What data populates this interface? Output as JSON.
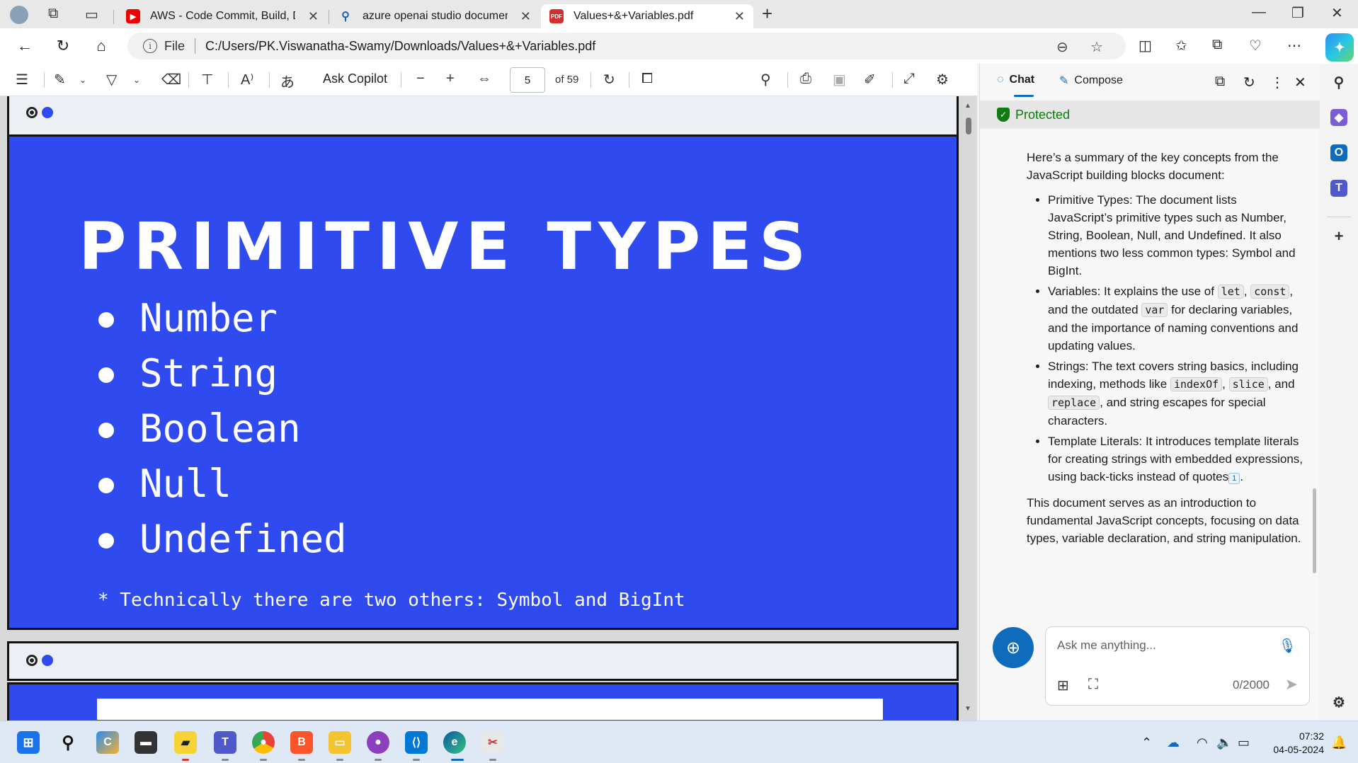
{
  "browser": {
    "tabs": [
      {
        "label": "AWS - Code Commit, Build, Depl",
        "icon": "youtube-icon"
      },
      {
        "label": "azure openai studio documentat",
        "icon": "search-icon"
      },
      {
        "label": "Values+&+Variables.pdf",
        "icon": "pdf-icon",
        "active": true
      }
    ],
    "address": {
      "scheme_label": "File",
      "url": "C:/Users/PK.Viswanatha-Swamy/Downloads/Values+&+Variables.pdf"
    }
  },
  "pdf_toolbar": {
    "ask_copilot": "Ask Copilot",
    "page_current": "5",
    "page_total": "of 59"
  },
  "slide": {
    "title": "PRIMITIVE TYPES",
    "items": [
      "Number",
      "String",
      "Boolean",
      "Null",
      "Undefined"
    ],
    "note": "* Technically there are two others: Symbol and BigInt"
  },
  "copilot": {
    "tabs": {
      "chat": "Chat",
      "compose": "Compose"
    },
    "protected": "Protected",
    "intro": "Here’s a summary of the key concepts from the JavaScript building blocks document:",
    "bullets": {
      "b1": "Primitive Types: The document lists JavaScript’s primitive types such as Number, String, Boolean, Null, and Undefined. It also mentions two less common types: Symbol and BigInt.",
      "b2_a": "Variables: It explains the use of ",
      "b2_code1": "let",
      "b2_b": ", ",
      "b2_code2": "const",
      "b2_c": ", and the outdated ",
      "b2_code3": "var",
      "b2_d": " for declaring variables, and the importance of naming conventions and updating values.",
      "b3_a": "Strings: The text covers string basics, including indexing, methods like ",
      "b3_code1": "indexOf",
      "b3_b": ", ",
      "b3_code2": "slice",
      "b3_c": ", and ",
      "b3_code3": "replace",
      "b3_d": ", and string escapes for special characters.",
      "b4": "Template Literals: It introduces template literals for creating strings with embedded expressions, using back-ticks instead of quotes",
      "b4_cite": "1",
      "b4_end": "."
    },
    "outro": "This document serves as an introduction to fundamental JavaScript concepts, focusing on data types, variable declaration, and string manipulation.",
    "input_placeholder": "Ask me anything...",
    "char_counter": "0/2000"
  },
  "taskbar": {
    "time": "07:32",
    "date": "04-05-2024"
  },
  "colors": {
    "slide_blue": "#2f4bf0",
    "accent": "#0f6cbd",
    "protected_green": "#0e7a0d"
  }
}
